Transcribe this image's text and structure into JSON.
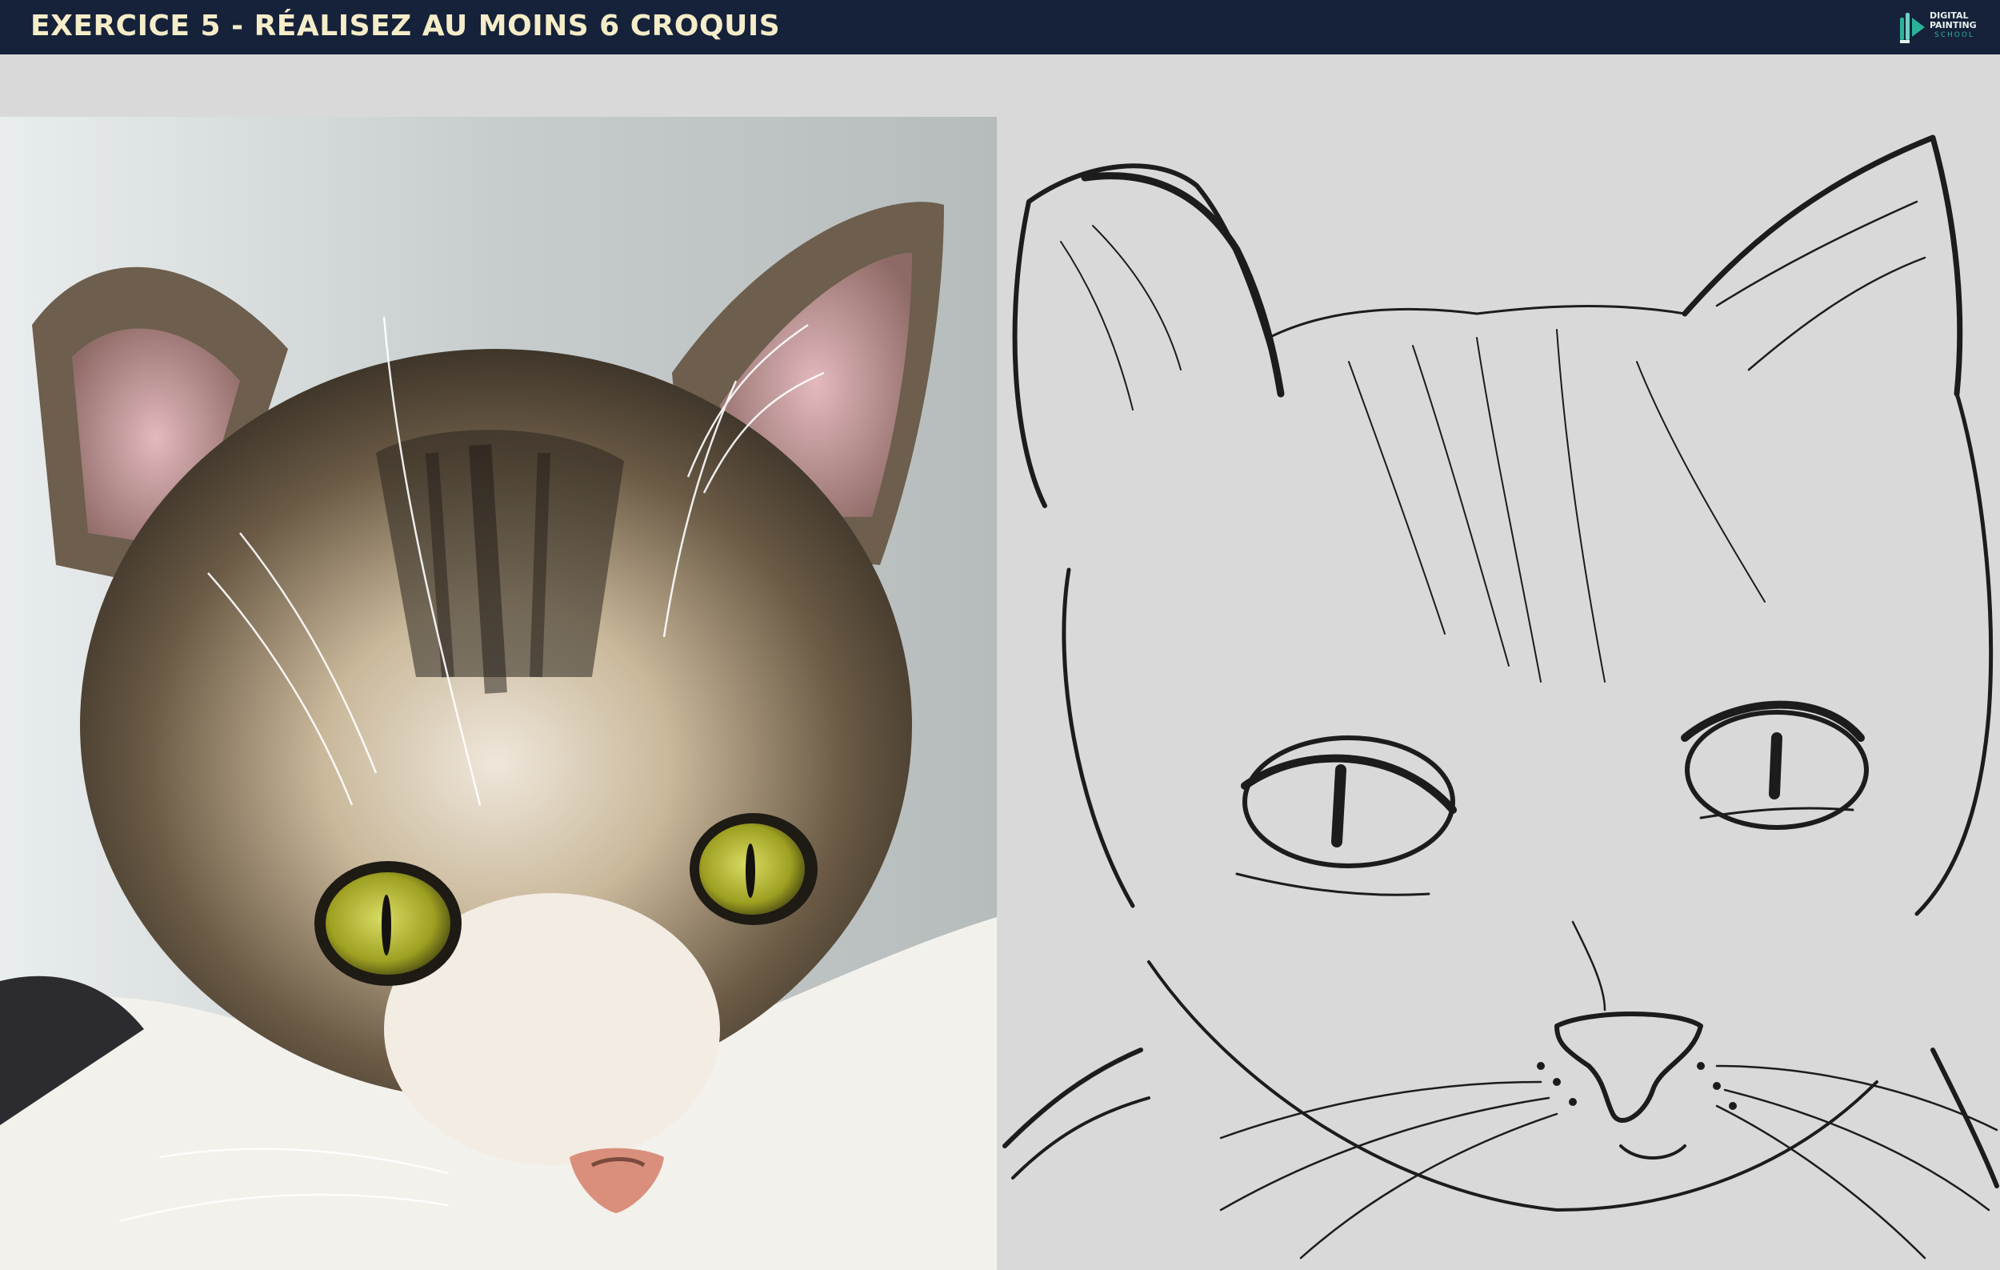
{
  "header": {
    "title": "EXERCICE 5 - RÉALISEZ AU MOINS 6 CROQUIS",
    "background": "#16213a",
    "title_color": "#f4edc8"
  },
  "logo": {
    "line1": "DIGITAL",
    "line2": "PAINTING",
    "line3": "SCHOOL",
    "icon": "paintbrush-logo-icon",
    "accent": "#2bb39a"
  },
  "page": {
    "background": "#d9d9d9"
  },
  "panels": {
    "reference": "tabby-cat-photo",
    "sketch": "cat-line-sketch"
  }
}
